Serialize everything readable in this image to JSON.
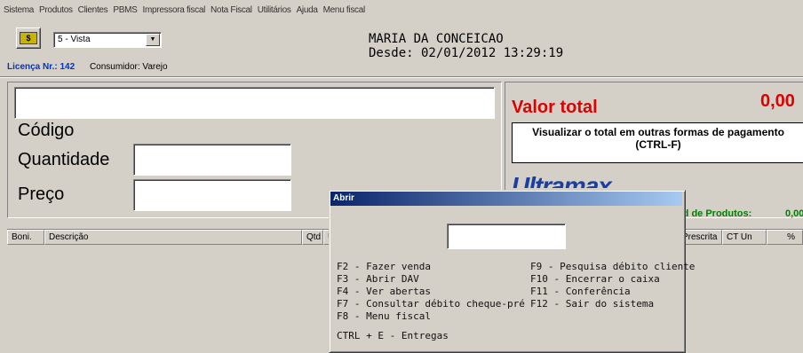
{
  "menu": [
    "Sistema",
    "Produtos",
    "Clientes",
    "PBMS",
    "Impressora fiscal",
    "Nota Fiscal",
    "Utilitários",
    "Ajuda",
    "Menu fiscal"
  ],
  "top": {
    "money_icon_text": "$",
    "payment_select": "5 - Vista",
    "licenca_label": "Licença Nr.: 142",
    "consumidor": "Consumidor: Varejo",
    "cliente_nome": "MARIA DA CONCEICAO",
    "desde": "Desde: 02/01/2012 13:29:19"
  },
  "entry": {
    "codigo_label": "Código",
    "quantidade_label": "Quantidade",
    "preco_label": "Preço",
    "top_input_value": "",
    "quantidade_value": "",
    "preco_value": ""
  },
  "totals": {
    "valor_total_label": "Valor total",
    "valor_total": "0,00",
    "visualizar_line1": "Visualizar o total em outras formas de pagamento",
    "visualizar_line2": "(CTRL-F)",
    "logo_text": "Ultramax",
    "qtd_produtos_label": "td de Produtos:",
    "qtd_produtos_value": "0,00"
  },
  "grid": {
    "columns": [
      "Boni.",
      "Descrição",
      "Qtd",
      "U",
      "Prescrita",
      "CT Un",
      "%"
    ]
  },
  "dialog": {
    "title": "Abrir",
    "input_value": "",
    "left_keys": [
      "F2 - Fazer venda",
      "F3 - Abrir DAV",
      "F4 - Ver abertas",
      "F7 - Consultar débito cheque-pré",
      "F8 - Menu fiscal"
    ],
    "right_keys": [
      "F9 - Pesquisa débito cliente",
      "F10 - Encerrar o caixa",
      "F11 - Conferência",
      "F12 - Sair do sistema"
    ],
    "extra": "CTRL + E - Entregas"
  }
}
